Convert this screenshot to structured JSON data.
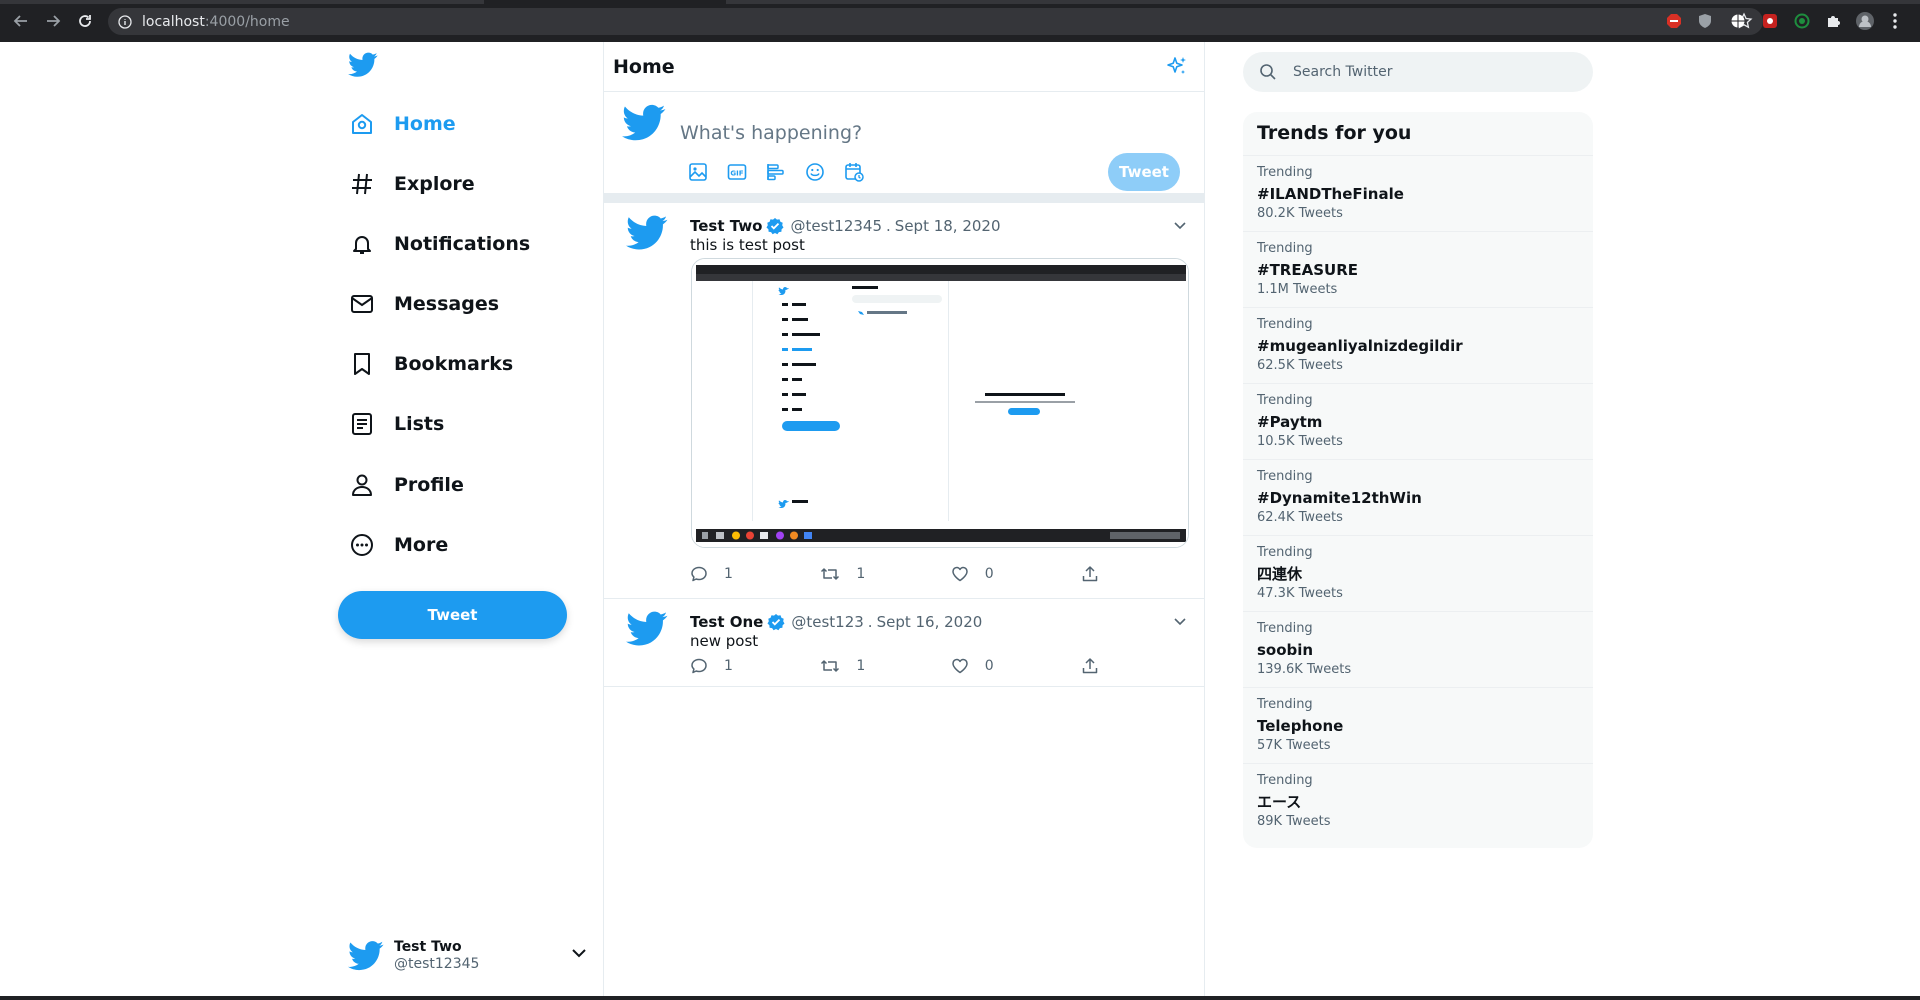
{
  "browser": {
    "url_host": "localhost",
    "url_path": ":4000/home"
  },
  "nav": {
    "items": [
      {
        "label": "Home",
        "icon": "home-icon",
        "active": true
      },
      {
        "label": "Explore",
        "icon": "hashtag-icon",
        "active": false
      },
      {
        "label": "Notifications",
        "icon": "bell-icon",
        "active": false
      },
      {
        "label": "Messages",
        "icon": "envelope-icon",
        "active": false
      },
      {
        "label": "Bookmarks",
        "icon": "bookmark-icon",
        "active": false
      },
      {
        "label": "Lists",
        "icon": "list-icon",
        "active": false
      },
      {
        "label": "Profile",
        "icon": "person-icon",
        "active": false
      },
      {
        "label": "More",
        "icon": "more-circle-icon",
        "active": false
      }
    ],
    "tweet_button": "Tweet"
  },
  "account": {
    "name": "Test Two",
    "handle": "@test12345"
  },
  "feed": {
    "title": "Home",
    "composer_placeholder": "What's happening?",
    "composer_button": "Tweet",
    "tweets": [
      {
        "name": "Test Two",
        "handle": "@test12345",
        "dot": ".",
        "date": "Sept 18, 2020",
        "text": "this is test post",
        "replies": "1",
        "retweets": "1",
        "likes": "0"
      },
      {
        "name": "Test One",
        "handle": "@test123",
        "dot": ".",
        "date": "Sept 16, 2020",
        "text": "new post",
        "replies": "1",
        "retweets": "1",
        "likes": "0"
      }
    ]
  },
  "search": {
    "placeholder": "Search Twitter"
  },
  "trends": {
    "title": "Trends for you",
    "items": [
      {
        "kicker": "Trending",
        "name": "#ILANDTheFinale",
        "count": "80.2K Tweets"
      },
      {
        "kicker": "Trending",
        "name": "#TREASURE",
        "count": "1.1M Tweets"
      },
      {
        "kicker": "Trending",
        "name": "#mugeanliyalnizdegildir",
        "count": "62.5K Tweets"
      },
      {
        "kicker": "Trending",
        "name": "#Paytm",
        "count": "10.5K Tweets"
      },
      {
        "kicker": "Trending",
        "name": "#Dynamite12thWin",
        "count": "62.4K Tweets"
      },
      {
        "kicker": "Trending",
        "name": "四連休",
        "count": "47.3K Tweets"
      },
      {
        "kicker": "Trending",
        "name": "soobin",
        "count": "139.6K Tweets"
      },
      {
        "kicker": "Trending",
        "name": "Telephone",
        "count": "57K Tweets"
      },
      {
        "kicker": "Trending",
        "name": "エース",
        "count": "89K Tweets"
      }
    ]
  },
  "colors": {
    "brand": "#1d9bf0",
    "brand_light": "#8ecdf8",
    "chrome": "#202124"
  }
}
